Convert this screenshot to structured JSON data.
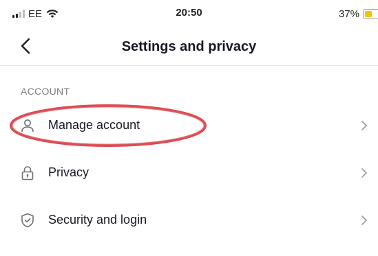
{
  "status_bar": {
    "carrier": "EE",
    "time": "20:50",
    "battery_percent": "37%",
    "battery_level": 0.37,
    "signal_bars_active": 2,
    "signal_bars_total": 4
  },
  "header": {
    "back_icon": "chevron-left-icon",
    "title": "Settings and privacy"
  },
  "section": {
    "header": "ACCOUNT",
    "items": [
      {
        "label": "Manage account",
        "icon": "user-icon",
        "highlighted": true
      },
      {
        "label": "Privacy",
        "icon": "lock-icon",
        "highlighted": false
      },
      {
        "label": "Security and login",
        "icon": "shield-icon",
        "highlighted": false
      }
    ]
  },
  "colors": {
    "highlight_ring": "#d9393f",
    "text": "#161823",
    "secondary_text": "#7a7b80",
    "icon": "#6f7076",
    "battery": "#f5c400"
  }
}
